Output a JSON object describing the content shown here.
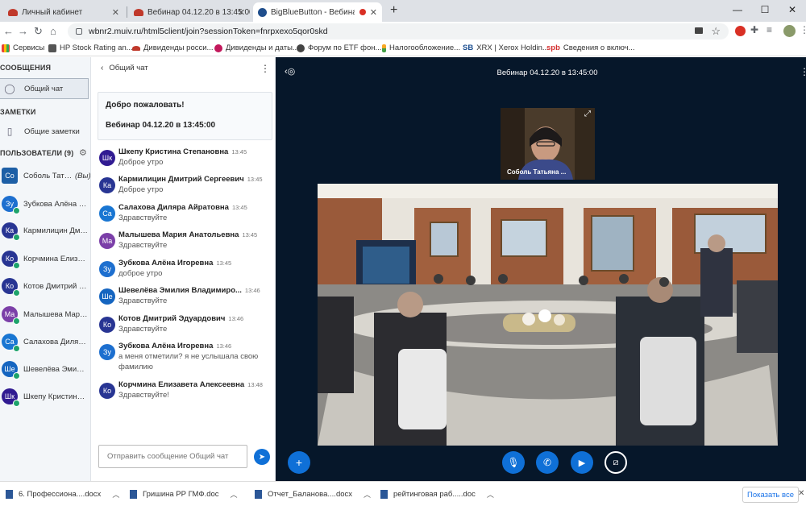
{
  "browser": {
    "tabs": [
      {
        "title": "Личный кабинет",
        "active": false
      },
      {
        "title": "Вебинар 04.12.20 в 13:45:00",
        "active": false
      },
      {
        "title": "BigBlueButton - Вебинар 04",
        "active": true
      }
    ],
    "new_tab": "+",
    "url": "wbnr2.muiv.ru/html5client/join?sessionToken=fnrpxexo5qor0skd",
    "bookmarks": [
      "Сервисы",
      "HP Stock Rating an...",
      "Дивиденды росси...",
      "Дивиденды и даты...",
      "Форум по ETF фон...",
      "Налогообложение...",
      "XRX | Xerox Holdin...",
      "Сведения о включ..."
    ],
    "bookmark_prefix_sb": "SB",
    "bookmark_prefix_spb": "spb"
  },
  "sidebar": {
    "messages_heading": "СООБЩЕНИЯ",
    "public_chat": "Общий чат",
    "notes_heading": "ЗАМЕТКИ",
    "shared_notes": "Общие заметки",
    "users_heading": "ПОЛЬЗОВАТЕЛИ (9)",
    "users": [
      {
        "initials": "Со",
        "name": "Соболь Татья...",
        "you": "(Вы)",
        "color": "#1d5fa6"
      },
      {
        "initials": "Зу",
        "name": "Зубкова Алёна Иг...",
        "color": "#1d6fcf"
      },
      {
        "initials": "Ка",
        "name": "Кармилицин Дмит...",
        "color": "#283593"
      },
      {
        "initials": "Ко",
        "name": "Корчмина Елизаве...",
        "color": "#283593"
      },
      {
        "initials": "Ко",
        "name": "Котов Дмитрий Эд...",
        "color": "#283593"
      },
      {
        "initials": "Ма",
        "name": "Малышева Мария ...",
        "color": "#7b3fa8"
      },
      {
        "initials": "Са",
        "name": "Салахова Диляра ...",
        "color": "#1976d2"
      },
      {
        "initials": "Ше",
        "name": "Шевелёва Эмилия...",
        "color": "#1565c0"
      },
      {
        "initials": "Шк",
        "name": "Шкепу Кристина С...",
        "color": "#311b92"
      }
    ]
  },
  "chat": {
    "title": "Общий чат",
    "welcome_line1": "Добро пожаловать!",
    "welcome_line2": "Вебинар 04.12.20 в 13:45:00",
    "messages": [
      {
        "initials": "Шк",
        "name": "Шкепу Кристина Степановна",
        "time": "13:45",
        "text": "Доброе утро",
        "color": "#311b92"
      },
      {
        "initials": "Ка",
        "name": "Кармилицин Дмитрий Сергеевич",
        "time": "13:45",
        "text": "Доброе утро",
        "color": "#283593"
      },
      {
        "initials": "Са",
        "name": "Салахова Диляра Айратовна",
        "time": "13:45",
        "text": "Здравствуйте",
        "color": "#1976d2"
      },
      {
        "initials": "Ма",
        "name": "Малышева Мария Анатольевна",
        "time": "13:45",
        "text": "Здравствуйте",
        "color": "#7b3fa8"
      },
      {
        "initials": "Зу",
        "name": "Зубкова Алёна Игоревна",
        "time": "13:45",
        "text": "доброе утро",
        "color": "#1d6fcf"
      },
      {
        "initials": "Ше",
        "name": "Шевелёва Эмилия Владимиро...",
        "time": "13:46",
        "text": "Здравствуйте",
        "color": "#1565c0"
      },
      {
        "initials": "Ко",
        "name": "Котов Дмитрий Эдуардович",
        "time": "13:46",
        "text": "Здравствуйте",
        "color": "#283593"
      },
      {
        "initials": "Зу",
        "name": "Зубкова Алёна Игоревна",
        "time": "13:46",
        "text": "а меня отметили? я не услышала свою фамилию",
        "color": "#1d6fcf"
      },
      {
        "initials": "Ко",
        "name": "Корчмина Елизавета Алексеевна",
        "time": "13:48",
        "text": "Здравствуйте!",
        "color": "#283593"
      }
    ],
    "input_placeholder": "Отправить сообщение Общий чат"
  },
  "stage": {
    "title": "Вебинар 04.12.20 в 13:45:00",
    "webcam_label": "Соболь Татьяна ..."
  },
  "downloads": {
    "items": [
      "6. Профессиона....docx",
      "Гришина РР ГМФ.doc",
      "Отчет_Баланова....docx",
      "рейтинговая раб.....doc"
    ],
    "show_all": "Показать все"
  },
  "colors": {
    "accent": "#0f70d7",
    "stage_bg": "#06172a",
    "mic_on": "#1ea36b"
  }
}
